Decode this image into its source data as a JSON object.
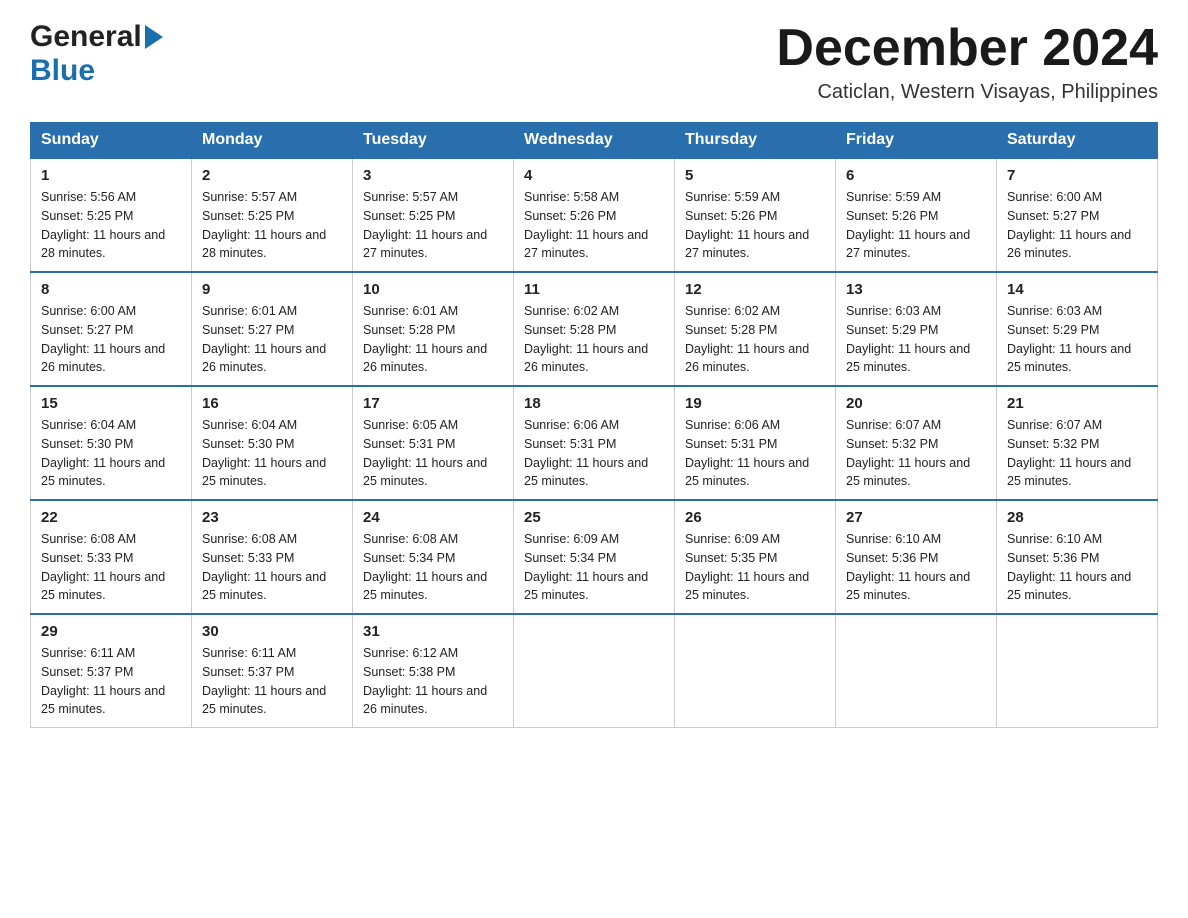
{
  "header": {
    "logo_general": "General",
    "logo_blue": "Blue",
    "month_title": "December 2024",
    "location": "Caticlan, Western Visayas, Philippines"
  },
  "weekdays": [
    "Sunday",
    "Monday",
    "Tuesday",
    "Wednesday",
    "Thursday",
    "Friday",
    "Saturday"
  ],
  "weeks": [
    [
      {
        "day": "1",
        "sunrise": "5:56 AM",
        "sunset": "5:25 PM",
        "daylight": "11 hours and 28 minutes."
      },
      {
        "day": "2",
        "sunrise": "5:57 AM",
        "sunset": "5:25 PM",
        "daylight": "11 hours and 28 minutes."
      },
      {
        "day": "3",
        "sunrise": "5:57 AM",
        "sunset": "5:25 PM",
        "daylight": "11 hours and 27 minutes."
      },
      {
        "day": "4",
        "sunrise": "5:58 AM",
        "sunset": "5:26 PM",
        "daylight": "11 hours and 27 minutes."
      },
      {
        "day": "5",
        "sunrise": "5:59 AM",
        "sunset": "5:26 PM",
        "daylight": "11 hours and 27 minutes."
      },
      {
        "day": "6",
        "sunrise": "5:59 AM",
        "sunset": "5:26 PM",
        "daylight": "11 hours and 27 minutes."
      },
      {
        "day": "7",
        "sunrise": "6:00 AM",
        "sunset": "5:27 PM",
        "daylight": "11 hours and 26 minutes."
      }
    ],
    [
      {
        "day": "8",
        "sunrise": "6:00 AM",
        "sunset": "5:27 PM",
        "daylight": "11 hours and 26 minutes."
      },
      {
        "day": "9",
        "sunrise": "6:01 AM",
        "sunset": "5:27 PM",
        "daylight": "11 hours and 26 minutes."
      },
      {
        "day": "10",
        "sunrise": "6:01 AM",
        "sunset": "5:28 PM",
        "daylight": "11 hours and 26 minutes."
      },
      {
        "day": "11",
        "sunrise": "6:02 AM",
        "sunset": "5:28 PM",
        "daylight": "11 hours and 26 minutes."
      },
      {
        "day": "12",
        "sunrise": "6:02 AM",
        "sunset": "5:28 PM",
        "daylight": "11 hours and 26 minutes."
      },
      {
        "day": "13",
        "sunrise": "6:03 AM",
        "sunset": "5:29 PM",
        "daylight": "11 hours and 25 minutes."
      },
      {
        "day": "14",
        "sunrise": "6:03 AM",
        "sunset": "5:29 PM",
        "daylight": "11 hours and 25 minutes."
      }
    ],
    [
      {
        "day": "15",
        "sunrise": "6:04 AM",
        "sunset": "5:30 PM",
        "daylight": "11 hours and 25 minutes."
      },
      {
        "day": "16",
        "sunrise": "6:04 AM",
        "sunset": "5:30 PM",
        "daylight": "11 hours and 25 minutes."
      },
      {
        "day": "17",
        "sunrise": "6:05 AM",
        "sunset": "5:31 PM",
        "daylight": "11 hours and 25 minutes."
      },
      {
        "day": "18",
        "sunrise": "6:06 AM",
        "sunset": "5:31 PM",
        "daylight": "11 hours and 25 minutes."
      },
      {
        "day": "19",
        "sunrise": "6:06 AM",
        "sunset": "5:31 PM",
        "daylight": "11 hours and 25 minutes."
      },
      {
        "day": "20",
        "sunrise": "6:07 AM",
        "sunset": "5:32 PM",
        "daylight": "11 hours and 25 minutes."
      },
      {
        "day": "21",
        "sunrise": "6:07 AM",
        "sunset": "5:32 PM",
        "daylight": "11 hours and 25 minutes."
      }
    ],
    [
      {
        "day": "22",
        "sunrise": "6:08 AM",
        "sunset": "5:33 PM",
        "daylight": "11 hours and 25 minutes."
      },
      {
        "day": "23",
        "sunrise": "6:08 AM",
        "sunset": "5:33 PM",
        "daylight": "11 hours and 25 minutes."
      },
      {
        "day": "24",
        "sunrise": "6:08 AM",
        "sunset": "5:34 PM",
        "daylight": "11 hours and 25 minutes."
      },
      {
        "day": "25",
        "sunrise": "6:09 AM",
        "sunset": "5:34 PM",
        "daylight": "11 hours and 25 minutes."
      },
      {
        "day": "26",
        "sunrise": "6:09 AM",
        "sunset": "5:35 PM",
        "daylight": "11 hours and 25 minutes."
      },
      {
        "day": "27",
        "sunrise": "6:10 AM",
        "sunset": "5:36 PM",
        "daylight": "11 hours and 25 minutes."
      },
      {
        "day": "28",
        "sunrise": "6:10 AM",
        "sunset": "5:36 PM",
        "daylight": "11 hours and 25 minutes."
      }
    ],
    [
      {
        "day": "29",
        "sunrise": "6:11 AM",
        "sunset": "5:37 PM",
        "daylight": "11 hours and 25 minutes."
      },
      {
        "day": "30",
        "sunrise": "6:11 AM",
        "sunset": "5:37 PM",
        "daylight": "11 hours and 25 minutes."
      },
      {
        "day": "31",
        "sunrise": "6:12 AM",
        "sunset": "5:38 PM",
        "daylight": "11 hours and 26 minutes."
      },
      null,
      null,
      null,
      null
    ]
  ],
  "labels": {
    "sunrise_prefix": "Sunrise: ",
    "sunset_prefix": "Sunset: ",
    "daylight_prefix": "Daylight: "
  }
}
